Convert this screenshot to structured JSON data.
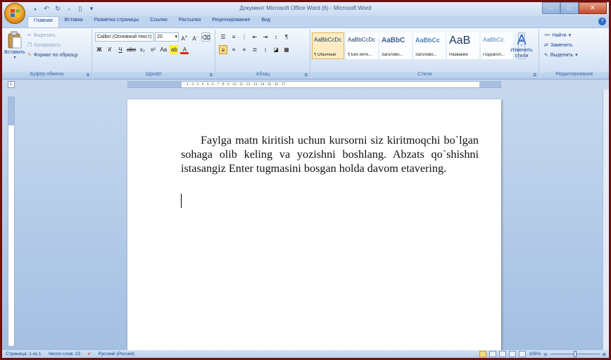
{
  "window": {
    "title": "Документ Microsoft Office Word (6) - Microsoft Word"
  },
  "tabs": [
    "Главная",
    "Вставка",
    "Разметка страницы",
    "Ссылки",
    "Рассылки",
    "Рецензирование",
    "Вид"
  ],
  "clipboard": {
    "paste": "Вставить",
    "cut": "Вырезать",
    "copy": "Копировать",
    "format_painter": "Формат по образцу",
    "group_label": "Буфер обмена"
  },
  "font": {
    "family": "Calibri (Основной текст)",
    "size": "20",
    "group_label": "Шрифт"
  },
  "paragraph": {
    "group_label": "Абзац"
  },
  "styles": {
    "items": [
      {
        "sample": "AaBbCcDc",
        "name": "¶ Обычный"
      },
      {
        "sample": "AaBbCcDc",
        "name": "¶ Без инте..."
      },
      {
        "sample": "AaBbC",
        "name": "Заголово..."
      },
      {
        "sample": "AaBbCc",
        "name": "Заголово..."
      },
      {
        "sample": "AaB",
        "name": "Название"
      },
      {
        "sample": "AaBbCc.",
        "name": "Подзагол..."
      }
    ],
    "change_styles": "Изменить стили",
    "group_label": "Стили"
  },
  "editing": {
    "find": "Найти",
    "replace": "Заменить",
    "select": "Выделить",
    "group_label": "Редактирование"
  },
  "document": {
    "paragraph": "Faylga matn kiritish uchun kursorni siz kiritmoqchi bo`lgan sohaga olib keling va yozishni boshlang. Abzats qo`shishni istasangiz Enter tugmasini bosgan holda davom etavering."
  },
  "status": {
    "page": "Страница: 1 из 1",
    "words": "Число слов: 23",
    "language": "Русский (Россия)",
    "zoom": "105%",
    "zoom_value": 105
  }
}
